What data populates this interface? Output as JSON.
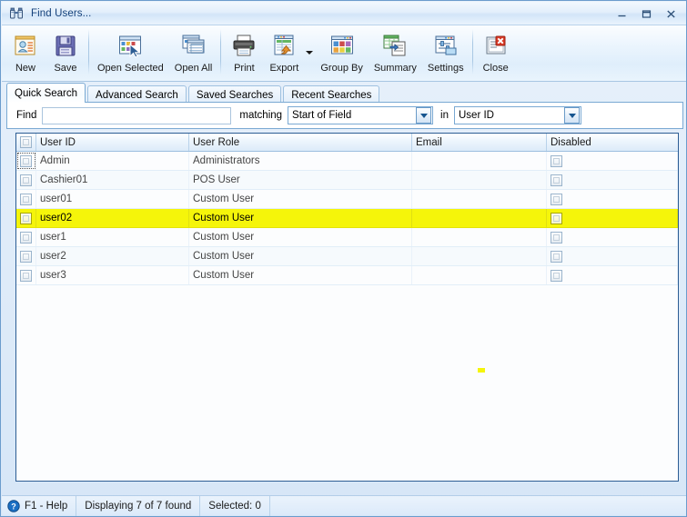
{
  "window": {
    "title": "Find Users...",
    "title_icon": "binoculars-icon",
    "minimize_label": "–",
    "maximize_label": "❐",
    "close_label": "✕"
  },
  "toolbar": {
    "items": [
      {
        "label": "New",
        "icon": "new-user-card-icon"
      },
      {
        "label": "Save",
        "icon": "floppy-disk-icon"
      },
      {
        "label": "Open Selected",
        "icon": "open-selected-window-icon"
      },
      {
        "label": "Open All",
        "icon": "open-all-windows-icon"
      },
      {
        "label": "Print",
        "icon": "printer-icon"
      },
      {
        "label": "Export",
        "icon": "export-table-arrow-icon"
      },
      {
        "label": "Group By",
        "icon": "group-by-grid-icon"
      },
      {
        "label": "Summary",
        "icon": "summary-report-icon"
      },
      {
        "label": "Settings",
        "icon": "settings-sliders-icon"
      },
      {
        "label": "Close",
        "icon": "close-document-red-x-icon"
      }
    ],
    "export_dropdown_icon": "caret-down-icon"
  },
  "tabs": [
    {
      "label": "Quick Search",
      "active": true
    },
    {
      "label": "Advanced Search",
      "active": false
    },
    {
      "label": "Saved Searches",
      "active": false
    },
    {
      "label": "Recent Searches",
      "active": false
    }
  ],
  "search": {
    "find_label": "Find",
    "find_value": "",
    "find_placeholder": "",
    "matching_label": "matching",
    "matching_value": "Start of Field",
    "in_label": "in",
    "in_value": "User ID"
  },
  "grid": {
    "columns": [
      "",
      "User ID",
      "User Role",
      "Email",
      "Disabled"
    ],
    "rows": [
      {
        "user_id": "Admin",
        "user_role": "Administrators",
        "email": "",
        "disabled": false,
        "selected": false,
        "focus": true
      },
      {
        "user_id": "Cashier01",
        "user_role": "POS User",
        "email": "",
        "disabled": false,
        "selected": false,
        "focus": false
      },
      {
        "user_id": "user01",
        "user_role": "Custom User",
        "email": "",
        "disabled": false,
        "selected": false,
        "focus": false
      },
      {
        "user_id": "user02",
        "user_role": "Custom User",
        "email": "",
        "disabled": false,
        "selected": true,
        "focus": false
      },
      {
        "user_id": "user1",
        "user_role": "Custom User",
        "email": "",
        "disabled": false,
        "selected": false,
        "focus": false
      },
      {
        "user_id": "user2",
        "user_role": "Custom User",
        "email": "",
        "disabled": false,
        "selected": false,
        "focus": false
      },
      {
        "user_id": "user3",
        "user_role": "Custom User",
        "email": "",
        "disabled": false,
        "selected": false,
        "focus": false
      }
    ]
  },
  "statusbar": {
    "help": "F1 - Help",
    "help_icon": "help-question-icon",
    "displaying": "Displaying 7 of 7 found",
    "selected": "Selected: 0"
  },
  "colors": {
    "selection_yellow": "#f5f50a",
    "title_text": "#13407a",
    "grid_border": "#2c5d94",
    "accent_blue": "#7aa9d3"
  }
}
